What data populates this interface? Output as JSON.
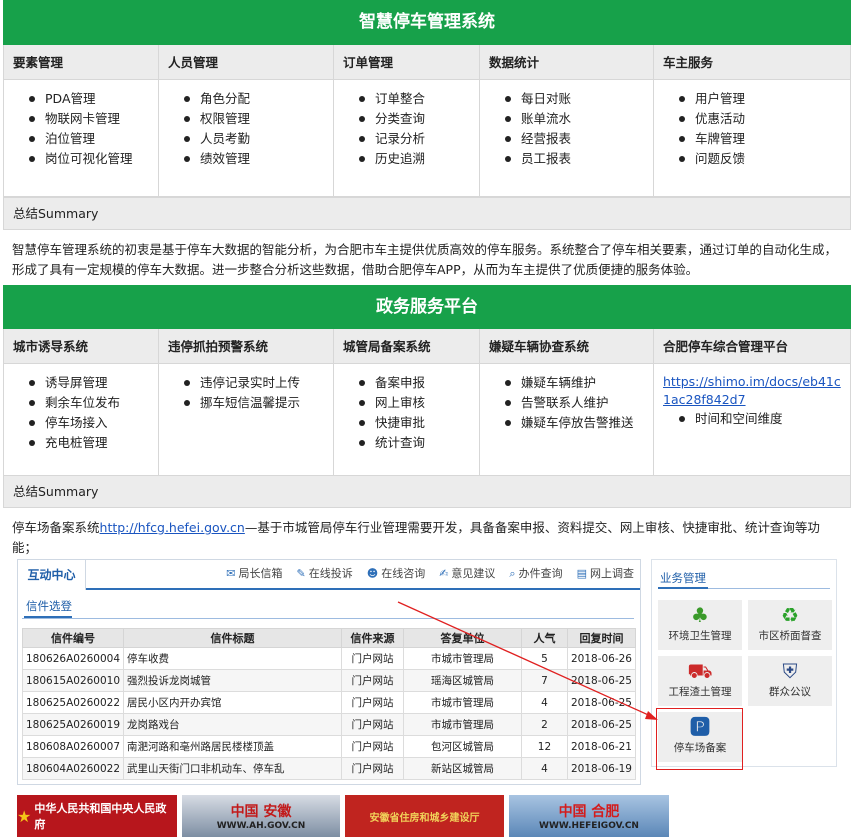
{
  "section1": {
    "title": "智慧停车管理系统",
    "columns": [
      {
        "header": "要素管理",
        "items": [
          "PDA管理",
          "物联网卡管理",
          "泊位管理",
          "岗位可视化管理"
        ]
      },
      {
        "header": "人员管理",
        "items": [
          "角色分配",
          "权限管理",
          "人员考勤",
          "绩效管理"
        ]
      },
      {
        "header": "订单管理",
        "items": [
          "订单整合",
          "分类查询",
          "记录分析",
          "历史追溯"
        ]
      },
      {
        "header": "数据统计",
        "items": [
          "每日对账",
          "账单流水",
          "经营报表",
          "员工报表"
        ]
      },
      {
        "header": "车主服务",
        "items": [
          "用户管理",
          "优惠活动",
          "车牌管理",
          "问题反馈"
        ]
      }
    ],
    "summary_header": "总结Summary",
    "summary": "智慧停车管理系统的初衷是基于停车大数据的智能分析，为合肥市车主提供优质高效的停车服务。系统整合了停车相关要素，通过订单的自动化生成，形成了具有一定规模的停车大数据。进一步整合分析这些数据，借助合肥停车APP，从而为车主提供了优质便捷的服务体验。"
  },
  "section2": {
    "title": "政务服务平台",
    "columns": [
      {
        "header": "城市诱导系统",
        "items": [
          "诱导屏管理",
          "剩余车位发布",
          "停车场接入",
          "充电桩管理"
        ]
      },
      {
        "header": "违停抓拍预警系统",
        "items": [
          "违停记录实时上传",
          "挪车短信温馨提示"
        ]
      },
      {
        "header": "城管局备案系统",
        "items": [
          "备案申报",
          "网上审核",
          "快捷审批",
          "统计查询"
        ]
      },
      {
        "header": "嫌疑车辆协查系统",
        "items": [
          "嫌疑车辆维护",
          "告警联系人维护",
          "嫌疑车停放告警推送"
        ]
      },
      {
        "header": "合肥停车综合管理平台",
        "link": "https://shimo.im/docs/eb41c1ac28f842d7",
        "items": [
          "时间和空间维度"
        ]
      }
    ],
    "summary_header": "总结Summary",
    "summary_prefix": "停车场备案系统",
    "summary_link": "http://hfcg.hefei.gov.cn",
    "summary_rest": "—基于市城管局停车行业管理需要开发，具备备案申报、资料提交、网上审核、快捷审批、统计查询等功能；"
  },
  "screenshot": {
    "tab": "互动中心",
    "links": [
      "局长信箱",
      "在线投诉",
      "在线咨询",
      "意见建议",
      "办件查询",
      "网上调查"
    ],
    "subtab": "信件选登",
    "columns": [
      "信件编号",
      "信件标题",
      "信件来源",
      "答复单位",
      "人气",
      "回复时间"
    ],
    "rows": [
      [
        "180626A0260004",
        "停车收费",
        "门户网站",
        "市城市管理局",
        "5",
        "2018-06-26"
      ],
      [
        "180615A0260010",
        "强烈投诉龙岗城管",
        "门户网站",
        "瑶海区城管局",
        "7",
        "2018-06-25"
      ],
      [
        "180625A0260022",
        "居民小区内开办宾馆",
        "门户网站",
        "市城市管理局",
        "4",
        "2018-06-25"
      ],
      [
        "180625A0260019",
        "龙岗路戏台",
        "门户网站",
        "市城市管理局",
        "2",
        "2018-06-25"
      ],
      [
        "180608A0260007",
        "南淝河路和亳州路居民楼楼顶盖",
        "门户网站",
        "包河区城管局",
        "12",
        "2018-06-21"
      ],
      [
        "180604A0260022",
        "武里山天街门口非机动车、停车乱",
        "门户网站",
        "新站区城管局",
        "4",
        "2018-06-19"
      ]
    ],
    "biz_title": "业务管理",
    "tiles": [
      {
        "label": "环境卫生管理",
        "icon": "tree-icon"
      },
      {
        "label": "市区桥面督查",
        "icon": "recycle-icon"
      },
      {
        "label": "工程渣土管理",
        "icon": "truck-icon"
      },
      {
        "label": "群众公议",
        "icon": "badge-icon"
      },
      {
        "label": "停车场备案",
        "icon": "parking-icon"
      }
    ],
    "logos": [
      "中华人民共和国中央人民政府",
      "中国 安徽",
      "安徽省住房和城乡建设厅",
      "中国 合肥"
    ],
    "logo_subs": [
      "",
      "WWW.AH.GOV.CN",
      "",
      "WWW.HEFEIGOV.CN"
    ]
  },
  "colors": {
    "green": "#17a14a",
    "link": "#1a55c0",
    "highlight": "#e02020"
  }
}
